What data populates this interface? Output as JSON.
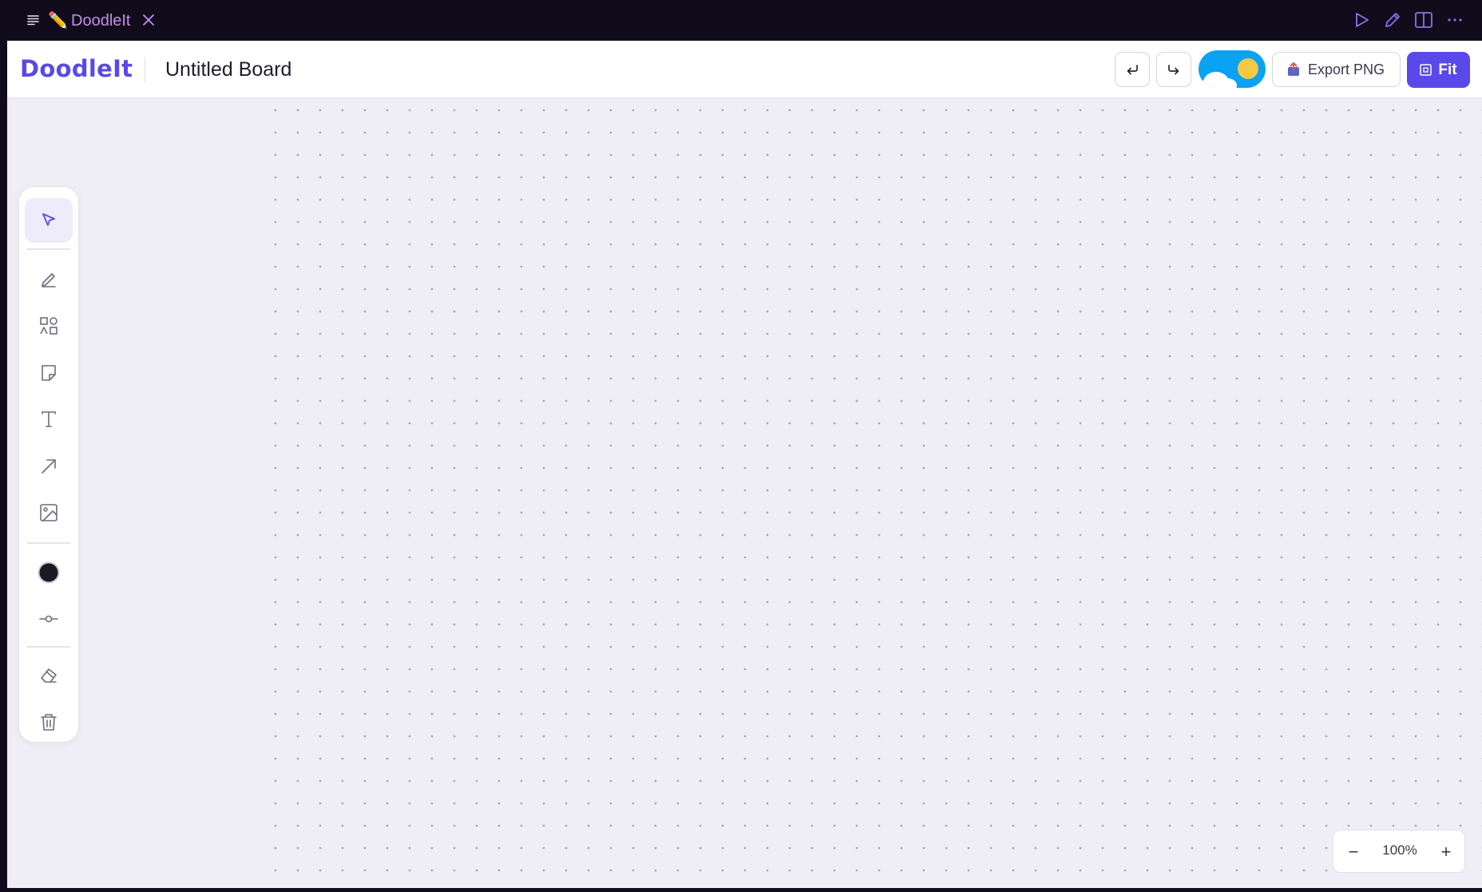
{
  "tabbar": {
    "tab_emoji": "✏️",
    "tab_title": "DoodleIt",
    "icons": [
      "menu-icon",
      "play-icon",
      "edit-icon",
      "split-view-icon",
      "more-icon"
    ]
  },
  "header": {
    "logo": "DoodleIt",
    "board_title": "Untitled Board",
    "export_label": "Export PNG",
    "fit_label": "Fit"
  },
  "toolbar": {
    "tools": [
      "select",
      "pen",
      "shapes",
      "sticky-note",
      "text",
      "arrow",
      "image",
      "color",
      "stroke-width",
      "eraser",
      "delete"
    ],
    "active_tool": "select",
    "current_color": "#1b1a22"
  },
  "zoom": {
    "minus": "−",
    "level": "100%",
    "plus": "+"
  },
  "colors": {
    "accent": "#5949ea",
    "tab_title": "#c48ef0",
    "toggle_bg": "#0aa2f2",
    "sun": "#f7c843"
  }
}
